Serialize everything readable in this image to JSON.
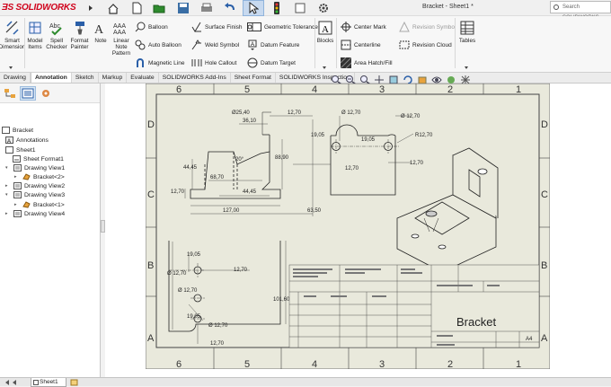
{
  "app": {
    "logo_text": "SOLIDWORKS",
    "doc_title": "Bracket - Sheet1 *",
    "search_placeholder": "Search SOLIDWORKS"
  },
  "ribbon": {
    "smart_dimension": "Smart\nDimension",
    "model_items": "Model\nItems",
    "spell_checker": "Spell\nChecker",
    "format_painter": "Format\nPainter",
    "note": "Note",
    "linear_note_pattern": "Linear\nNote\nPattern",
    "balloon": "Balloon",
    "auto_balloon": "Auto Balloon",
    "magnetic_line": "Magnetic Line",
    "surface_finish": "Surface Finish",
    "weld_symbol": "Weld Symbol",
    "hole_callout": "Hole Callout",
    "geometric_tolerance": "Geometric Tolerance",
    "datum_feature": "Datum Feature",
    "datum_target": "Datum Target",
    "blocks": "Blocks",
    "center_mark": "Center Mark",
    "centerline": "Centerline",
    "area_hatch_fill": "Area Hatch/Fill",
    "revision_symbol": "Revision Symbol",
    "revision_cloud": "Revision Cloud",
    "tables": "Tables"
  },
  "tabs": [
    "Drawing",
    "Annotation",
    "Sketch",
    "Markup",
    "Evaluate",
    "SOLIDWORKS Add-Ins",
    "Sheet Format",
    "SOLIDWORKS Inspection"
  ],
  "active_tab": "Annotation",
  "tree": {
    "root": "Bracket",
    "annotations": "Annotations",
    "sheet1": "Sheet1",
    "sheet_format1": "Sheet Format1",
    "drawing_view1": "Drawing View1",
    "bracket2": "Bracket<2>",
    "drawing_view2": "Drawing View2",
    "drawing_view3": "Drawing View3",
    "bracket1": "Bracket<1>",
    "drawing_view4": "Drawing View4"
  },
  "sheet_tab": "Sheet1",
  "drawing": {
    "zones_x": [
      "6",
      "5",
      "4",
      "3",
      "2",
      "1"
    ],
    "zones_y": [
      "D",
      "C",
      "B",
      "A"
    ],
    "title_block_name": "Bracket",
    "title_block_size": "A4",
    "dims": {
      "d25": "Ø25,40",
      "d3610": "36,10",
      "d1270a": "12,70",
      "d1270c": "Ø 12,70",
      "d1270d": "Ø 12,70",
      "d1905": "19,05",
      "d1905b": "19,05",
      "r1270": "R12,70",
      "d8890": "88,90",
      "d4445": "44,45",
      "d6870": "68,70",
      "d4445b": "44,45",
      "d1270b": "12,70",
      "d127": "127,00",
      "d6350": "63,50",
      "d20": "20°",
      "d1270e": "12,70",
      "d1270f": "12,70",
      "d1270g": "12,70",
      "v_d1270": "Ø 12,70",
      "v_1270": "12,70",
      "v_d1270b": "Ø 12,70",
      "v_1905": "19,05",
      "v_1905b": "19,05",
      "v_d1270c": "Ø 12,70",
      "v_10160": "101,60",
      "v_1270b": "12,70"
    }
  },
  "colors": {
    "sheet_bg": "#e9e9dc",
    "accent": "#d0021b",
    "line": "#333333"
  }
}
